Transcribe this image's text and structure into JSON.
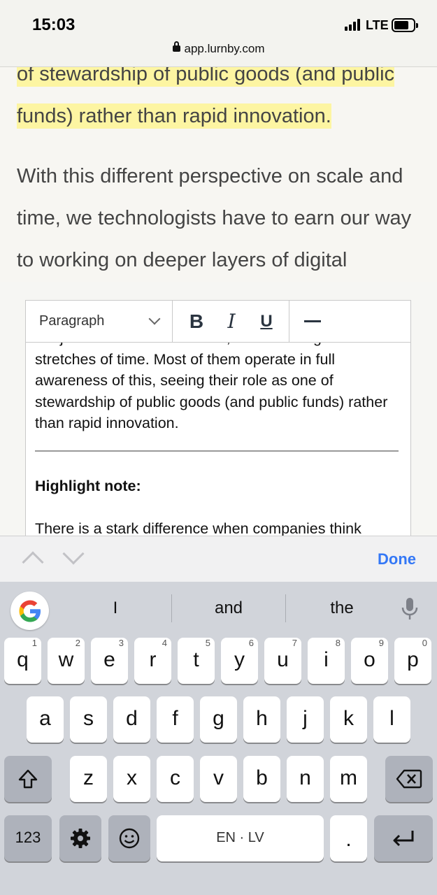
{
  "status_bar": {
    "time": "15:03",
    "network": "LTE",
    "url": "app.lurnby.com"
  },
  "article": {
    "highlight_line1": "of stewardship of public goods (and public",
    "highlight_line2": "funds) rather than rapid innovation.",
    "paragraph": "With this different perspective on scale and time, we technologists have to earn our way to working on deeper layers of digital"
  },
  "editor": {
    "block_format": "Paragraph",
    "bold_label": "B",
    "italic_label": "I",
    "underline_label": "U",
    "clipped_line": "not just at enormous breadth, but over long",
    "body_text": "stretches of time. Most of them operate in full awareness of this, seeing their role as one of stewardship of public goods (and public funds) rather than rapid innovation.",
    "note_title": "Highlight note:",
    "note_text": "There is a stark difference when companies think"
  },
  "accessory_bar": {
    "done_label": "Done"
  },
  "keyboard": {
    "suggestions": [
      "I",
      "and",
      "the"
    ],
    "row1": [
      {
        "k": "q",
        "n": "1"
      },
      {
        "k": "w",
        "n": "2"
      },
      {
        "k": "e",
        "n": "3"
      },
      {
        "k": "r",
        "n": "4"
      },
      {
        "k": "t",
        "n": "5"
      },
      {
        "k": "y",
        "n": "6"
      },
      {
        "k": "u",
        "n": "7"
      },
      {
        "k": "i",
        "n": "8"
      },
      {
        "k": "o",
        "n": "9"
      },
      {
        "k": "p",
        "n": "0"
      }
    ],
    "row2": [
      "a",
      "s",
      "d",
      "f",
      "g",
      "h",
      "j",
      "k",
      "l"
    ],
    "row3": [
      "z",
      "x",
      "c",
      "v",
      "b",
      "n",
      "m"
    ],
    "numbers_label": "123",
    "space_label": "EN · LV",
    "period_label": "."
  },
  "colors": {
    "highlight": "#fdf5a2",
    "accent": "#3478f6"
  }
}
